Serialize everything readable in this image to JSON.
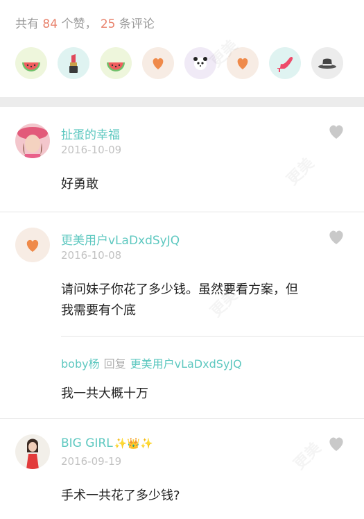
{
  "likes": {
    "prefix": "共有",
    "like_count": "84",
    "like_word": "个赞，",
    "comment_count": "25",
    "comment_word": "条评论",
    "avatars": [
      {
        "icon": "watermelon-icon",
        "bg": "#eef6dc"
      },
      {
        "icon": "lipstick-icon",
        "bg": "#dff3f1"
      },
      {
        "icon": "watermelon-icon",
        "bg": "#eef6dc"
      },
      {
        "icon": "heart-icon",
        "bg": "#f7ece4"
      },
      {
        "icon": "panda-icon",
        "bg": "#f0eaf6"
      },
      {
        "icon": "heart-icon",
        "bg": "#f7ece4"
      },
      {
        "icon": "high-heel-icon",
        "bg": "#dff3f1"
      },
      {
        "icon": "hat-icon",
        "bg": "#ececec"
      }
    ]
  },
  "comments": [
    {
      "username": "扯蛋的幸福",
      "date": "2016-10-09",
      "text": "好勇敢",
      "avatar": "photo-avatar-pink"
    },
    {
      "username": "更美用户vLaDxdSyJQ",
      "date": "2016-10-08",
      "text_line1": "请问妹子你花了多少钱。虽然要看方案，但",
      "text_line2": "我需要有个底",
      "avatar": "heart-avatar",
      "reply": {
        "from": "boby杨",
        "verb": "回复",
        "to": "更美用户vLaDxdSyJQ",
        "text": "我一共大概十万"
      }
    },
    {
      "username": "BIG GIRL",
      "username_emoji": "✨👑✨",
      "date": "2016-09-19",
      "text": "手术一共花了多少钱?",
      "avatar": "photo-avatar-red"
    }
  ],
  "colors": {
    "accent_teal": "#5ec8c0",
    "count_orange": "#e8826c",
    "like_gray": "#c9c9c9"
  }
}
